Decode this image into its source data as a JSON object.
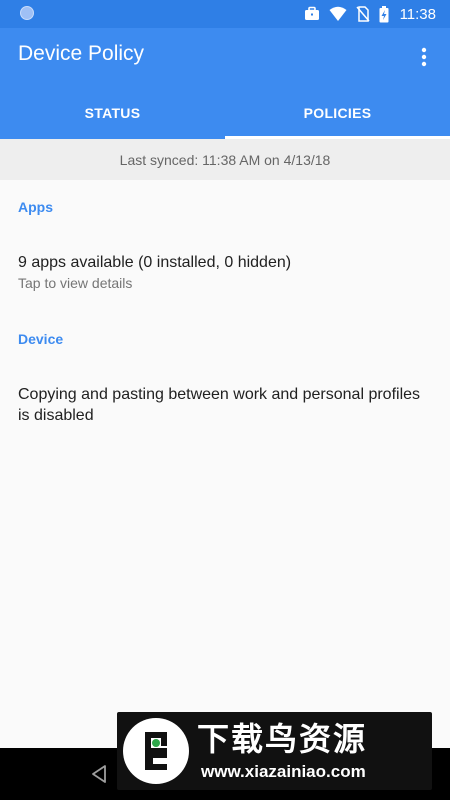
{
  "status_bar": {
    "time": "11:38",
    "icons": [
      "notification-dot-icon",
      "work-briefcase-icon",
      "wifi-icon",
      "no-sim-icon",
      "battery-charging-icon"
    ]
  },
  "app_bar": {
    "title": "Device Policy",
    "overflow_icon": "more-vert-icon"
  },
  "tabs": [
    {
      "label": "STATUS",
      "active": false
    },
    {
      "label": "POLICIES",
      "active": true
    }
  ],
  "sync": {
    "text": "Last synced: 11:38 AM on 4/13/18"
  },
  "sections": {
    "apps": {
      "header": "Apps",
      "primary": "9 apps available (0 installed, 0 hidden)",
      "secondary": "Tap to view details"
    },
    "device": {
      "header": "Device",
      "primary": "Copying and pasting between work and personal profiles is disabled"
    }
  },
  "watermark": {
    "title": "下载鸟资源",
    "url": "www.xiazainiao.com"
  },
  "colors": {
    "status_bar": "#2f7fe6",
    "app_bar": "#3d8bf0",
    "accent": "#3d8bf0",
    "sync_bg": "#eeeeee",
    "background": "#fafafa"
  }
}
